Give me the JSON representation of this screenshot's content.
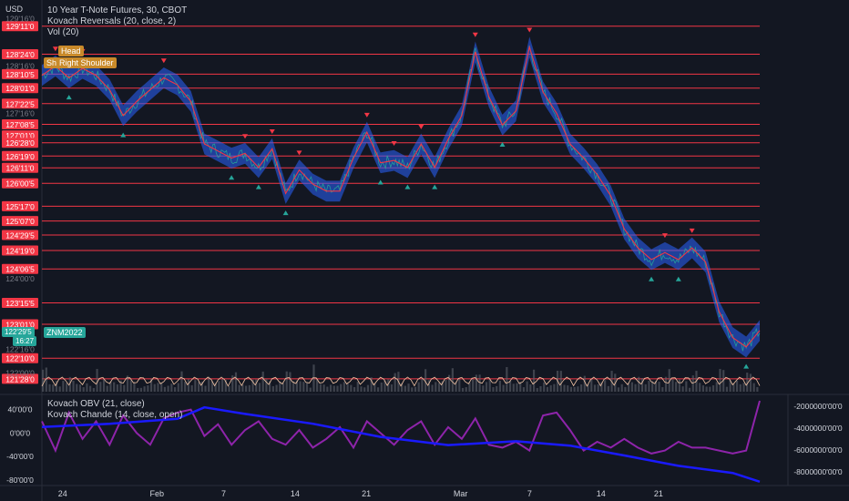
{
  "header": {
    "currency": "USD",
    "title": "10 Year T-Note Futures, 30, CBOT",
    "indicator1": "Kovach Reversals (20, close, 2)",
    "indicator2": "Vol (20)",
    "indicator3": "Kovach OBV (21, close)",
    "indicator4": "Kovach Chande (14, close, open)"
  },
  "annotations": {
    "head": "Head",
    "sh": "Sh",
    "right_shoulder": "Right Shoulder",
    "symbol_tag": "ZNM2022",
    "last_price": "122'29'5",
    "countdown": "16:27"
  },
  "colors": {
    "background": "#131722",
    "level_line": "#f23645",
    "level_label": "#f23645",
    "price_band": "#2962ff",
    "price_line": "#f23645",
    "up_marker": "#26a69a",
    "down_marker": "#f23645",
    "obv": "#1a1aff",
    "chande": "#8e24aa",
    "last_price_tag": "#26a69a",
    "annotation_tag": "#c98a2a"
  },
  "chart_data": {
    "type": "line",
    "title": "10 Year T-Note Futures, 30, CBOT",
    "x_ticks": [
      "24",
      "Feb",
      "7",
      "14",
      "21",
      "Mar",
      "7",
      "14",
      "21"
    ],
    "price_axis_ticks": [
      "129'16'0",
      "128'16'0",
      "127'16'0",
      "124'00'0",
      "122'16'0",
      "122'00'0"
    ],
    "levels": [
      "129'11'0",
      "128'24'0",
      "128'10'5",
      "128'01'0",
      "127'22'5",
      "127'08'5",
      "127'01'0",
      "126'28'0",
      "126'19'0",
      "126'11'0",
      "126'00'5",
      "125'17'0",
      "125'07'0",
      "124'29'5",
      "124'19'0",
      "124'06'5",
      "123'15'5",
      "123'01'0",
      "122'10'0",
      "121'28'0"
    ],
    "price_series": [
      [
        0,
        128.3
      ],
      [
        4,
        128.5
      ],
      [
        8,
        128.25
      ],
      [
        12,
        128.45
      ],
      [
        16,
        128.3
      ],
      [
        20,
        128.0
      ],
      [
        24,
        127.45
      ],
      [
        28,
        127.75
      ],
      [
        32,
        128.0
      ],
      [
        36,
        128.25
      ],
      [
        40,
        128.1
      ],
      [
        44,
        127.75
      ],
      [
        48,
        126.85
      ],
      [
        52,
        126.7
      ],
      [
        56,
        126.55
      ],
      [
        60,
        126.65
      ],
      [
        64,
        126.35
      ],
      [
        68,
        126.75
      ],
      [
        72,
        125.8
      ],
      [
        76,
        126.3
      ],
      [
        80,
        126.0
      ],
      [
        84,
        125.85
      ],
      [
        88,
        125.85
      ],
      [
        92,
        126.55
      ],
      [
        96,
        127.1
      ],
      [
        100,
        126.45
      ],
      [
        104,
        126.5
      ],
      [
        108,
        126.35
      ],
      [
        112,
        126.85
      ],
      [
        116,
        126.35
      ],
      [
        120,
        126.95
      ],
      [
        124,
        127.45
      ],
      [
        128,
        128.8
      ],
      [
        132,
        127.85
      ],
      [
        136,
        127.25
      ],
      [
        140,
        127.55
      ],
      [
        144,
        128.9
      ],
      [
        148,
        127.95
      ],
      [
        152,
        127.5
      ],
      [
        156,
        126.85
      ],
      [
        160,
        126.55
      ],
      [
        164,
        126.2
      ],
      [
        168,
        125.75
      ],
      [
        172,
        125.05
      ],
      [
        176,
        124.65
      ],
      [
        180,
        124.4
      ],
      [
        184,
        124.55
      ],
      [
        188,
        124.4
      ],
      [
        192,
        124.65
      ],
      [
        196,
        124.35
      ],
      [
        200,
        123.3
      ],
      [
        204,
        122.75
      ],
      [
        208,
        122.55
      ],
      [
        212,
        122.9
      ]
    ],
    "total_bars": 212,
    "obv_axis_ticks": [
      "-2000000'00'0",
      "-4000000'00'0",
      "-6000000'00'0",
      "-8000000'00'0"
    ],
    "obv_range": [
      -9000000,
      -1500000
    ],
    "obv_series": [
      [
        0,
        -3900000
      ],
      [
        20,
        -3600000
      ],
      [
        40,
        -3150000
      ],
      [
        48,
        -2100000
      ],
      [
        60,
        -2700000
      ],
      [
        80,
        -3600000
      ],
      [
        100,
        -4800000
      ],
      [
        120,
        -5550000
      ],
      [
        140,
        -5200000
      ],
      [
        156,
        -5600000
      ],
      [
        172,
        -6500000
      ],
      [
        188,
        -7450000
      ],
      [
        204,
        -8100000
      ],
      [
        212,
        -8900000
      ]
    ],
    "chande_axis_ticks": [
      "40'00'0",
      "0'00'0",
      "-40'00'0",
      "-80'00'0"
    ],
    "chande_range": [
      -85,
      55
    ],
    "chande_series": [
      [
        0,
        20
      ],
      [
        4,
        -30
      ],
      [
        8,
        35
      ],
      [
        12,
        -10
      ],
      [
        16,
        20
      ],
      [
        20,
        -20
      ],
      [
        24,
        30
      ],
      [
        28,
        0
      ],
      [
        32,
        -20
      ],
      [
        36,
        25
      ],
      [
        40,
        35
      ],
      [
        44,
        40
      ],
      [
        48,
        -5
      ],
      [
        52,
        15
      ],
      [
        56,
        -20
      ],
      [
        60,
        5
      ],
      [
        64,
        20
      ],
      [
        68,
        -10
      ],
      [
        72,
        -20
      ],
      [
        76,
        5
      ],
      [
        80,
        -25
      ],
      [
        84,
        -10
      ],
      [
        88,
        10
      ],
      [
        92,
        -25
      ],
      [
        96,
        20
      ],
      [
        100,
        0
      ],
      [
        104,
        -20
      ],
      [
        108,
        5
      ],
      [
        112,
        20
      ],
      [
        116,
        -20
      ],
      [
        120,
        10
      ],
      [
        124,
        -10
      ],
      [
        128,
        25
      ],
      [
        132,
        -20
      ],
      [
        136,
        -25
      ],
      [
        140,
        -15
      ],
      [
        144,
        -30
      ],
      [
        148,
        30
      ],
      [
        152,
        35
      ],
      [
        156,
        5
      ],
      [
        160,
        -30
      ],
      [
        164,
        -15
      ],
      [
        168,
        -25
      ],
      [
        172,
        -10
      ],
      [
        176,
        -25
      ],
      [
        180,
        -35
      ],
      [
        184,
        -30
      ],
      [
        188,
        -15
      ],
      [
        192,
        -25
      ],
      [
        196,
        -25
      ],
      [
        200,
        -30
      ],
      [
        204,
        -35
      ],
      [
        208,
        -30
      ],
      [
        212,
        55
      ]
    ],
    "xlabel": "",
    "ylabel": ""
  }
}
